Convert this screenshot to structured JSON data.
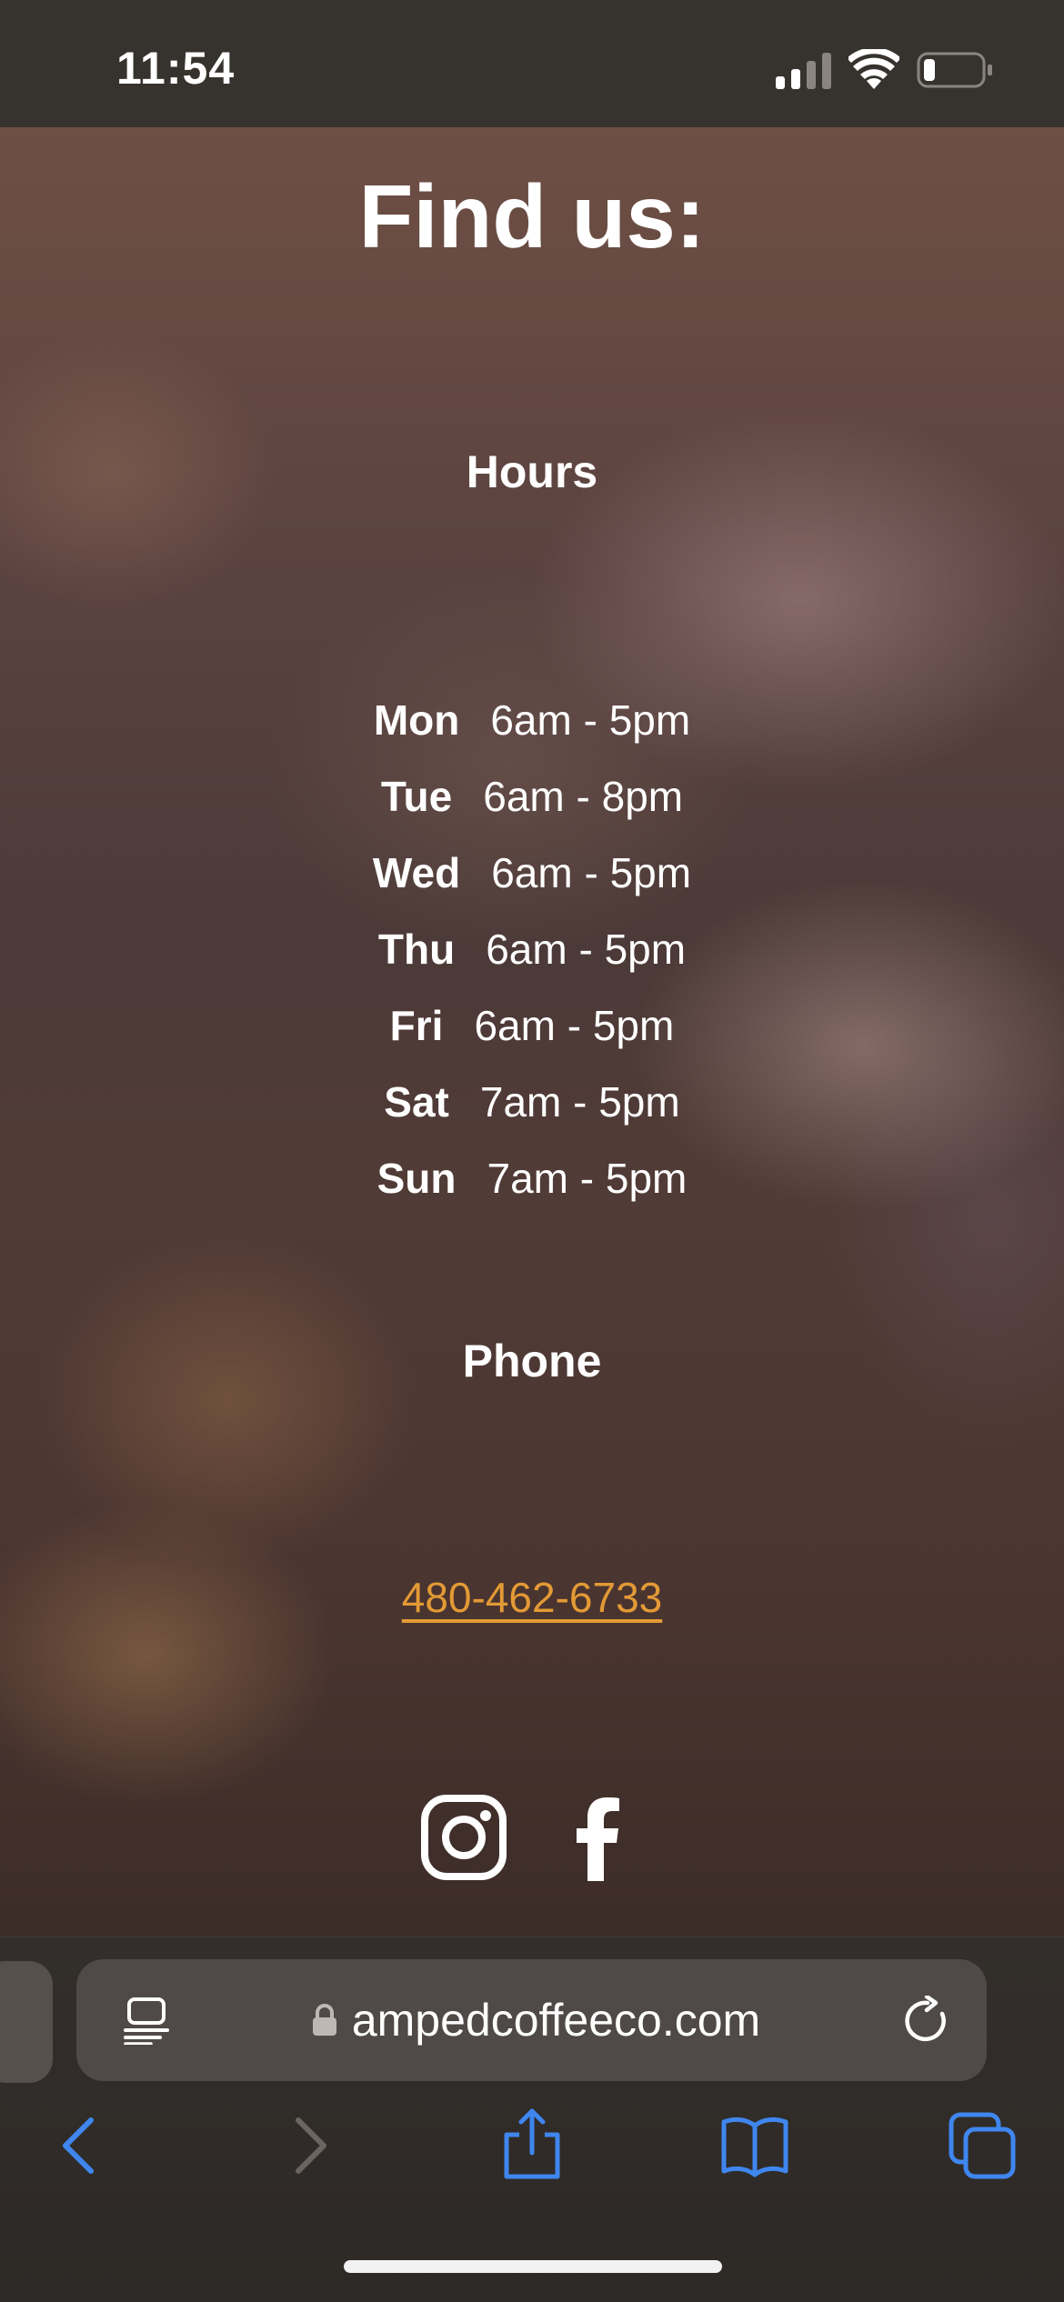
{
  "status_bar": {
    "time": "11:54",
    "icons": [
      "cellular-signal-icon",
      "wifi-icon",
      "battery-icon"
    ]
  },
  "page": {
    "heading": "Find us:",
    "hours": {
      "heading": "Hours",
      "rows": [
        {
          "day": "Mon",
          "time": "6am - 5pm"
        },
        {
          "day": "Tue",
          "time": "6am - 8pm"
        },
        {
          "day": "Wed",
          "time": "6am - 5pm"
        },
        {
          "day": "Thu",
          "time": "6am - 5pm"
        },
        {
          "day": "Fri",
          "time": "6am - 5pm"
        },
        {
          "day": "Sat",
          "time": "7am - 5pm"
        },
        {
          "day": "Sun",
          "time": "7am - 5pm"
        }
      ]
    },
    "phone": {
      "heading": "Phone",
      "number": "480-462-6733"
    },
    "social": [
      "instagram-icon",
      "facebook-icon"
    ]
  },
  "browser": {
    "url": "ampedcoffeeco.com",
    "toolbar_icons": [
      "back-icon",
      "forward-icon",
      "share-icon",
      "bookmarks-icon",
      "tabs-icon"
    ]
  },
  "colors": {
    "link": "#e39a35",
    "accent_blue": "#3f86ee",
    "status_bar_bg": "#36322d",
    "chrome_bg": "#2d2926"
  }
}
